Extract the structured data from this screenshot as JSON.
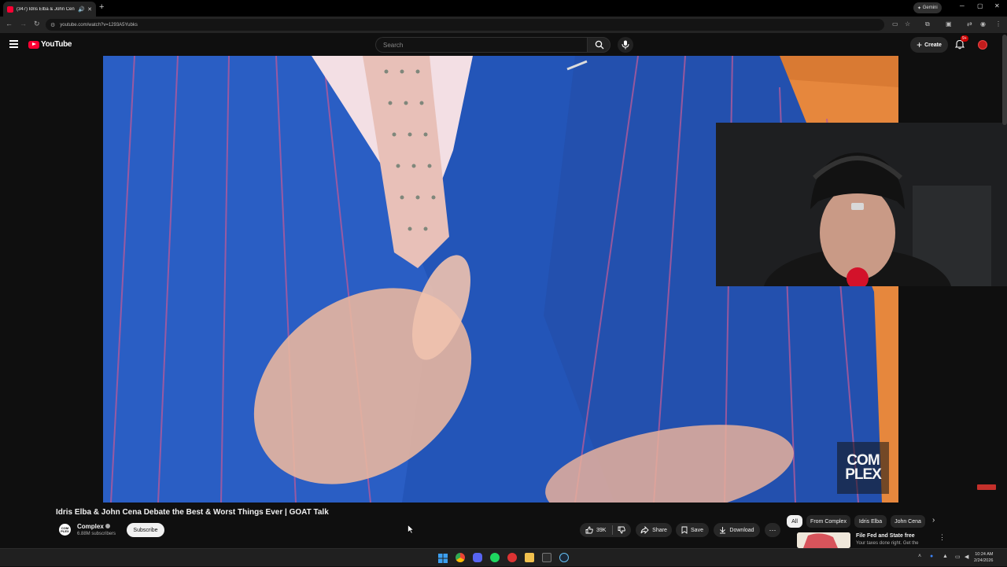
{
  "browser": {
    "tab_title": "(347) Idris Elba & John Cen",
    "url": "youtube.com/watch?v=1293A5Yubks",
    "gemini_label": "Gemini"
  },
  "youtube": {
    "logo_text": "YouTube",
    "search_placeholder": "Search",
    "create_label": "Create",
    "notification_count": "9+"
  },
  "video": {
    "watermark_line1": "COM",
    "watermark_line2": "PLEX",
    "title": "Idris Elba & John Cena Debate the Best & Worst Things Ever | GOAT Talk"
  },
  "channel": {
    "name": "Complex",
    "subscribers": "6.88M subscribers",
    "subscribe_label": "Subscribe",
    "avatar_text": "COM PLEX"
  },
  "actions": {
    "likes": "39K",
    "share": "Share",
    "save": "Save",
    "download": "Download"
  },
  "chips": [
    "All",
    "From Complex",
    "Idris Elba",
    "John Cena"
  ],
  "recommendation": {
    "title": "File Fed and State free",
    "subtitle": "Your taxes done right. Get the"
  },
  "taskbar": {
    "time": "10:24 AM",
    "date": "2/24/2026"
  },
  "colors": {
    "youtube_red": "#ff0033",
    "suit_blue": "#2355b8",
    "background": "#0f0f0f"
  }
}
